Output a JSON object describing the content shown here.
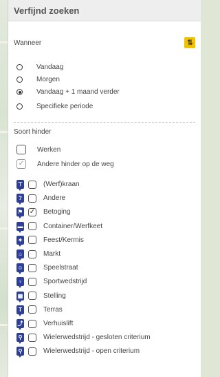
{
  "panel": {
    "title": "Verfijnd zoeken"
  },
  "when": {
    "label": "Wanneer",
    "sort_glyph": "⇅",
    "options": [
      {
        "label": "Vandaag",
        "checked": false
      },
      {
        "label": "Morgen",
        "checked": false
      },
      {
        "label": "Vandaag + 1 maand verder",
        "checked": true
      },
      {
        "label": "Specifieke periode",
        "checked": false
      }
    ]
  },
  "hinder": {
    "label": "Soort hinder",
    "groups": [
      {
        "label": "Werken",
        "checked": false
      },
      {
        "label": "Andere hinder op de weg",
        "checked": true
      }
    ],
    "categories": [
      {
        "label": "(Werf)kraan",
        "checked": false,
        "icon": "crane-icon",
        "glyph": "⊤"
      },
      {
        "label": "Andere",
        "checked": false,
        "icon": "question-icon",
        "glyph": "?"
      },
      {
        "label": "Betoging",
        "checked": true,
        "icon": "protest-icon",
        "glyph": "⚑"
      },
      {
        "label": "Container/Werfkeet",
        "checked": false,
        "icon": "container-icon",
        "glyph": "▬"
      },
      {
        "label": "Feest/Kermis",
        "checked": false,
        "icon": "party-icon",
        "glyph": "✦"
      },
      {
        "label": "Markt",
        "checked": false,
        "icon": "market-icon",
        "glyph": "⌂"
      },
      {
        "label": "Speelstraat",
        "checked": false,
        "icon": "playstreet-icon",
        "glyph": "☺"
      },
      {
        "label": "Sportwedstrijd",
        "checked": false,
        "icon": "sport-icon",
        "glyph": "♀"
      },
      {
        "label": "Stelling",
        "checked": false,
        "icon": "scaffold-icon",
        "glyph": "▦"
      },
      {
        "label": "Terras",
        "checked": false,
        "icon": "terrace-icon",
        "glyph": "T"
      },
      {
        "label": "Verhuislift",
        "checked": false,
        "icon": "moving-lift-icon",
        "glyph": "⤴"
      },
      {
        "label": "Wielerwedstrijd - gesloten criterium",
        "checked": false,
        "icon": "cycling-closed-icon",
        "glyph": "⚲"
      },
      {
        "label": "Wielerwedstrijd - open criterium",
        "checked": false,
        "icon": "cycling-open-icon",
        "glyph": "⚲"
      }
    ]
  },
  "colors": {
    "accent": "#f2c200",
    "icon_bg": "#2e3f99"
  }
}
